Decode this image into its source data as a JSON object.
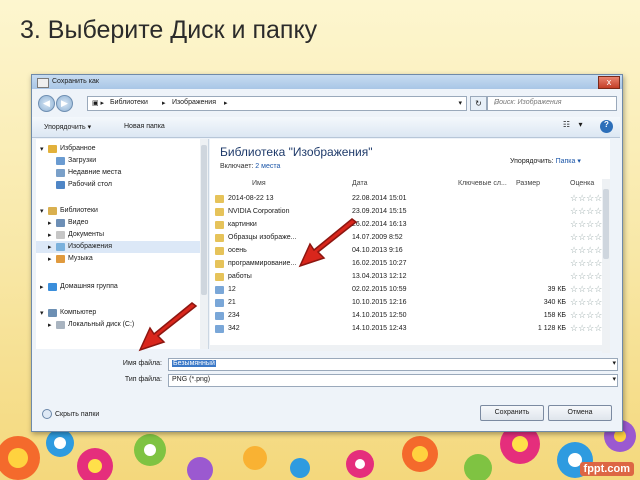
{
  "slide": {
    "title": "3. Выберите Диск и папку"
  },
  "dialog": {
    "title": "Сохранить как",
    "close": "x",
    "breadcrumb": [
      "Библиотеки",
      "Изображения"
    ],
    "search_placeholder": "Поиск: Изображения",
    "toolbar": {
      "organize": "Упорядочить ▾",
      "new_folder": "Новая папка"
    },
    "nav": [
      {
        "label": "Избранное",
        "icon": "star-icon",
        "color": "#e2b13b"
      },
      {
        "label": "Загрузки",
        "icon": "download-folder-icon",
        "color": "#6a9bd1"
      },
      {
        "label": "Недавние места",
        "icon": "recent-places-icon",
        "color": "#7aa0c9"
      },
      {
        "label": "Рабочий стол",
        "icon": "desktop-icon",
        "color": "#4f86c6"
      },
      {
        "label": "Библиотеки",
        "icon": "libraries-icon",
        "color": "#d9b050"
      },
      {
        "label": "Видео",
        "icon": "video-icon",
        "color": "#6d8fb6"
      },
      {
        "label": "Документы",
        "icon": "documents-icon",
        "color": "#c6c6c6"
      },
      {
        "label": "Изображения",
        "icon": "pictures-icon",
        "color": "#7bb1dc"
      },
      {
        "label": "Музыка",
        "icon": "music-icon",
        "color": "#e09a3e"
      },
      {
        "label": "Домашняя группа",
        "icon": "homegroup-icon",
        "color": "#3a8edb"
      },
      {
        "label": "Компьютер",
        "icon": "computer-icon",
        "color": "#6c8fb3"
      },
      {
        "label": "Локальный диск (C:)",
        "icon": "drive-icon",
        "color": "#a9b4c0"
      }
    ],
    "library": {
      "title": "Библиотека \"Изображения\"",
      "includes": "Включает:",
      "places": "2 места",
      "arrange_label": "Упорядочить:",
      "arrange_value": "Папка ▾"
    },
    "columns": {
      "name": "Имя",
      "date": "Дата",
      "keywords": "Ключевые сл...",
      "size": "Размер",
      "rating": "Оценка"
    },
    "files": [
      {
        "name": "2014-08-22 13",
        "date": "22.08.2014 15:01",
        "size": "",
        "type": "folder"
      },
      {
        "name": "NVIDIA Corporation",
        "date": "23.09.2014 15:15",
        "size": "",
        "type": "folder"
      },
      {
        "name": "картинки",
        "date": "26.02.2014 16:13",
        "size": "",
        "type": "folder"
      },
      {
        "name": "Образцы изображе...",
        "date": "14.07.2009 8:52",
        "size": "",
        "type": "folder"
      },
      {
        "name": "осень",
        "date": "04.10.2013 9:16",
        "size": "",
        "type": "folder"
      },
      {
        "name": "программирование...",
        "date": "16.02.2015 10:27",
        "size": "",
        "type": "folder"
      },
      {
        "name": "работы",
        "date": "13.04.2013 12:12",
        "size": "",
        "type": "folder"
      },
      {
        "name": "12",
        "date": "02.02.2015 10:59",
        "size": "39 КБ",
        "type": "image"
      },
      {
        "name": "21",
        "date": "10.10.2015 12:16",
        "size": "340 КБ",
        "type": "image"
      },
      {
        "name": "234",
        "date": "14.10.2015 12:50",
        "size": "158 КБ",
        "type": "image"
      },
      {
        "name": "342",
        "date": "14.10.2015 12:43",
        "size": "1 128 КБ",
        "type": "image"
      }
    ],
    "rating_stars": "☆☆☆☆☆",
    "filename_label": "Имя файла:",
    "filename_value": "Безымянный",
    "filetype_label": "Тип файла:",
    "filetype_value": "PNG (*.png)",
    "hide_folders": "Скрыть папки",
    "save": "Сохранить",
    "cancel": "Отмена"
  },
  "footer": {
    "logo": "fppt.com"
  }
}
